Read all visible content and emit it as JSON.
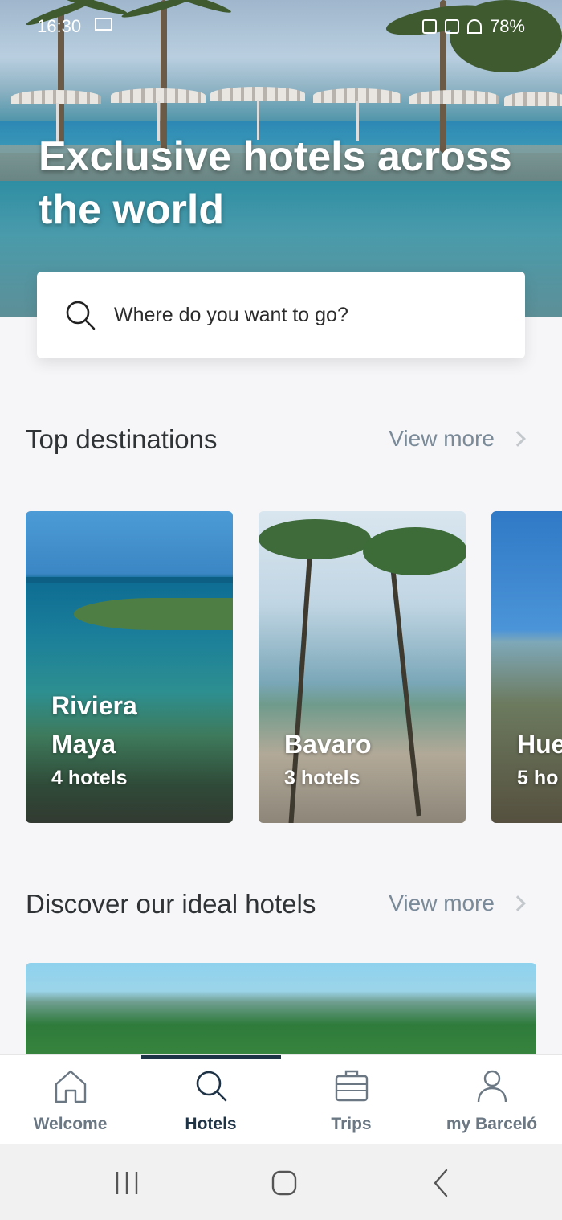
{
  "status_bar": {
    "time": "16:30",
    "battery": "78%"
  },
  "hero": {
    "title": "Exclusive hotels across the world"
  },
  "search": {
    "placeholder": "Where do you want to go?"
  },
  "top_destinations": {
    "title": "Top destinations",
    "view_more": "View more",
    "cards": [
      {
        "name_line1": "Riviera",
        "name_line2": "Maya",
        "count": "4 hotels"
      },
      {
        "name_line1": "Bavaro",
        "name_line2": "",
        "count": "3 hotels"
      },
      {
        "name_line1": "Hue",
        "name_line2": "",
        "count": "5 ho"
      }
    ]
  },
  "discover": {
    "title": "Discover our ideal hotels",
    "view_more": "View more"
  },
  "bottom_nav": {
    "items": [
      {
        "label": "Welcome",
        "icon": "home-icon"
      },
      {
        "label": "Hotels",
        "icon": "search-icon"
      },
      {
        "label": "Trips",
        "icon": "suitcase-icon"
      },
      {
        "label": "my Barceló",
        "icon": "user-icon"
      }
    ],
    "active_index": 1
  },
  "colors": {
    "accent": "#1f3346",
    "muted": "#7a8a98",
    "background": "#f6f6f8"
  }
}
